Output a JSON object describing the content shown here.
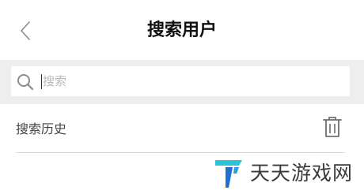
{
  "header": {
    "title": "搜索用户",
    "back_icon": "chevron-left-icon"
  },
  "search": {
    "placeholder": "搜索",
    "value": "",
    "icon": "search-icon"
  },
  "history": {
    "label": "搜索历史",
    "clear_icon": "trash-icon"
  },
  "watermark": {
    "text": "天天游戏网"
  },
  "colors": {
    "search_band": "#eeeeee",
    "title_text": "#111111",
    "logo_cyan": "#29c4d8",
    "logo_blue": "#1d6fd1",
    "divider": "#d8d8d8"
  }
}
